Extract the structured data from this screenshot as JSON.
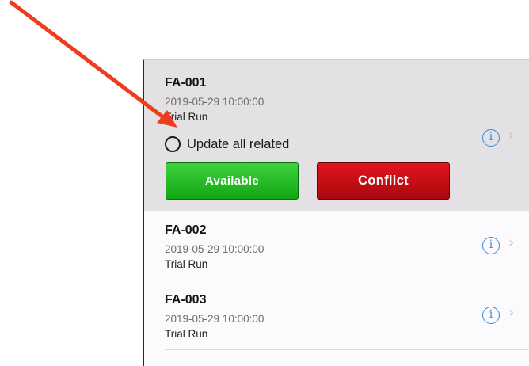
{
  "list": {
    "items": [
      {
        "code": "FA-001",
        "datetime": "2019-05-29 10:00:00",
        "type": "Trial Run",
        "selected": true,
        "update_all_label": "Update all related",
        "available_label": "Available",
        "conflict_label": "Conflict"
      },
      {
        "code": "FA-002",
        "datetime": "2019-05-29 10:00:00",
        "type": "Trial Run",
        "selected": false
      },
      {
        "code": "FA-003",
        "datetime": "2019-05-29 10:00:00",
        "type": "Trial Run",
        "selected": false
      }
    ]
  },
  "icons": {
    "info": "i",
    "chevron": "›"
  },
  "colors": {
    "available": "#1bb01b",
    "conflict": "#c8101a",
    "info_accent": "#2f8de0",
    "annotation_arrow": "#f03c1e",
    "selected_row_bg": "#e3e1e3"
  }
}
